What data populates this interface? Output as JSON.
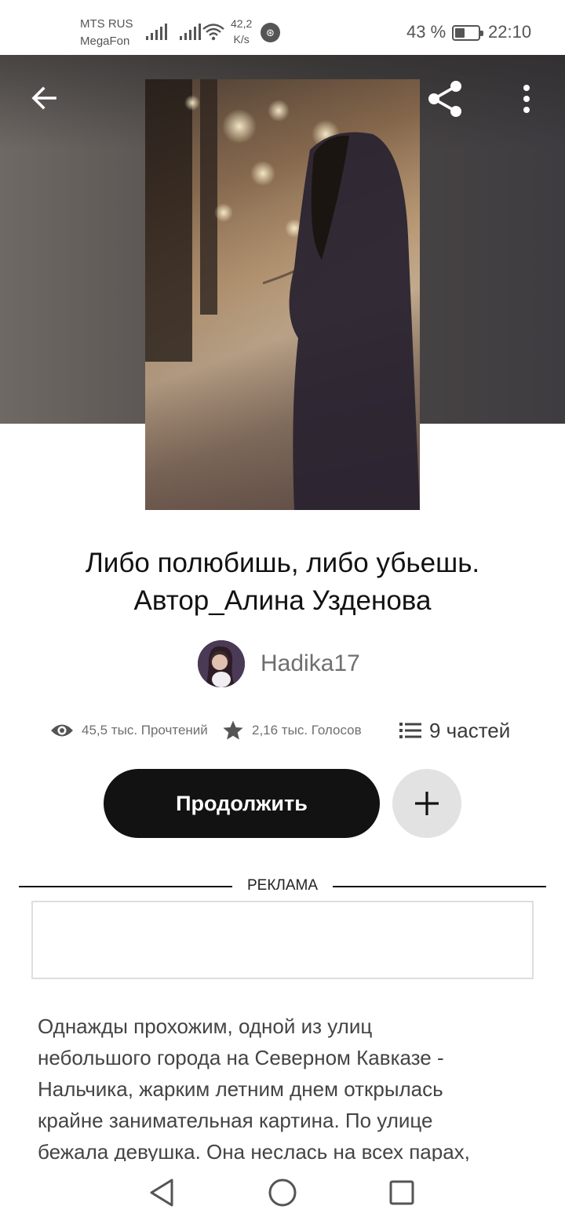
{
  "status_bar": {
    "carrier_1": "MTS RUS",
    "carrier_2": "MegaFon",
    "speed_value": "42,2",
    "speed_unit": "K/s",
    "battery_percent": "43 %",
    "battery_level": 0.43,
    "time": "22:10"
  },
  "header": {
    "back_icon": "arrow-left-icon",
    "share_icon": "share-icon",
    "more_icon": "more-vertical-icon"
  },
  "story": {
    "title_line_1": "Либо полюбишь, либо убьешь.",
    "title_line_2": "Автор_Алина Узденова",
    "author": "Hadika17",
    "reads_icon": "eye-icon",
    "reads": "45,5 тыс. Прочтений",
    "votes_icon": "star-icon",
    "votes": "2,16 тыс. Голосов",
    "parts_icon": "list-icon",
    "parts": "9 частей",
    "continue_label": "Продолжить",
    "add_icon": "plus-icon"
  },
  "ad": {
    "label": "РЕКЛАМА"
  },
  "description": {
    "lines": [
      "Однажды прохожим, одной из улиц",
      "небольшого города на Северном Кавказе -",
      "Нальчика, жарким летним днем открылась",
      "крайне занимательная картина. По улице",
      "бежала девушка. Она неслась на всех парах,"
    ]
  },
  "nav": {
    "back_icon": "triangle-back-icon",
    "home_icon": "circle-home-icon",
    "recents_icon": "square-recents-icon"
  }
}
